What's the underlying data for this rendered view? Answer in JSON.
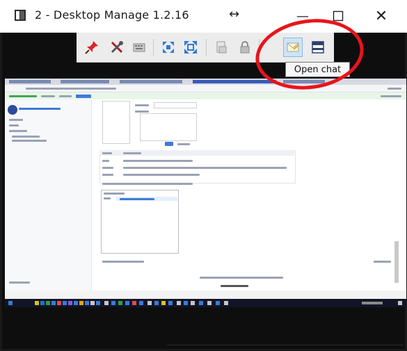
{
  "window": {
    "title": "2 - Desktop Manage 1.2.16",
    "resize_glyph": "↔",
    "minimize_glyph": "—",
    "maximize_glyph": "☐",
    "close_glyph": "✕"
  },
  "toolbar": {
    "buttons": [
      {
        "icon": "pin-icon"
      },
      {
        "icon": "tools-icon"
      },
      {
        "icon": "keyboard-icon"
      },
      {
        "icon": "fit-screen-icon"
      },
      {
        "icon": "fullscreen-icon"
      },
      {
        "icon": "file-transfer-icon"
      },
      {
        "icon": "lock-icon"
      },
      {
        "icon": "chat-icon"
      },
      {
        "icon": "monitor-icon"
      }
    ]
  },
  "tooltip": {
    "text": "Open chat"
  },
  "annotation": {
    "color": "#e8141c"
  }
}
